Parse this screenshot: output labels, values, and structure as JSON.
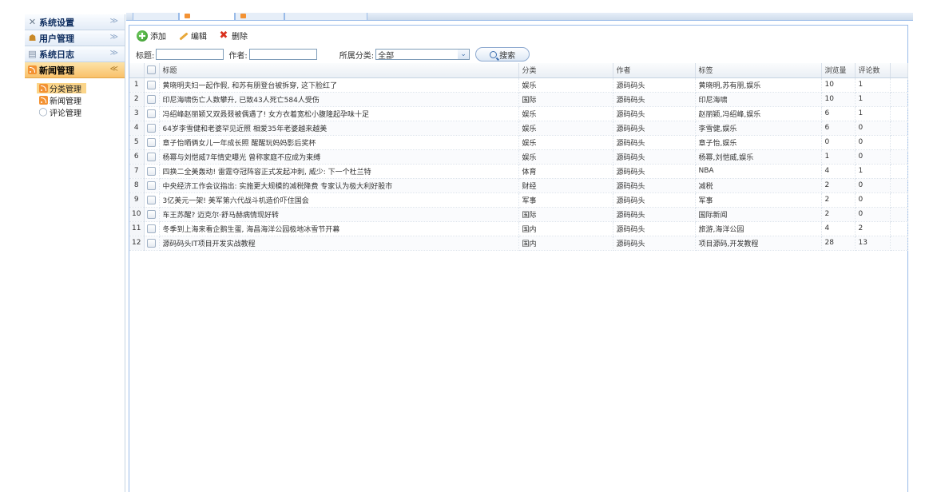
{
  "sidebar": {
    "sections": [
      {
        "label": "系统设置",
        "icon": "wrench-icon",
        "state": "collapsed"
      },
      {
        "label": "用户管理",
        "icon": "users-icon",
        "state": "collapsed"
      },
      {
        "label": "系统日志",
        "icon": "log-icon",
        "state": "collapsed"
      },
      {
        "label": "新闻管理",
        "icon": "rss-icon",
        "state": "expanded"
      }
    ],
    "news_items": [
      {
        "label": "分类管理",
        "icon": "rss-icon",
        "selected": true
      },
      {
        "label": "新闻管理",
        "icon": "rss-icon",
        "selected": false
      },
      {
        "label": "评论管理",
        "icon": "comment-icon",
        "selected": false
      }
    ]
  },
  "toolbar": {
    "add_label": "添加",
    "edit_label": "编辑",
    "delete_label": "删除"
  },
  "search": {
    "title_label": "标题:",
    "title_value": "",
    "author_label": "作者:",
    "author_value": "",
    "category_label": "所属分类:",
    "category_value": "全部",
    "search_button": "搜索"
  },
  "grid": {
    "columns": [
      "标题",
      "分类",
      "作者",
      "标签",
      "浏览量",
      "评论数"
    ],
    "rows": [
      {
        "n": "1",
        "title": "黄晓明夫妇一起作假, 和苏有朋登台被拆穿, 这下脸红了",
        "category": "娱乐",
        "author": "源码码头",
        "tags": "黄晓明,苏有朋,娱乐",
        "views": "10",
        "comments": "1"
      },
      {
        "n": "2",
        "title": "印尼海啸伤亡人数攀升, 已致43人死亡584人受伤",
        "category": "国际",
        "author": "源码码头",
        "tags": "印尼海啸",
        "views": "10",
        "comments": "1"
      },
      {
        "n": "3",
        "title": "冯绍峰赵丽颖又双叒叕被偶遇了! 女方衣着宽松小腹隆起孕味十足",
        "category": "娱乐",
        "author": "源码码头",
        "tags": "赵丽颖,冯绍峰,娱乐",
        "views": "6",
        "comments": "1"
      },
      {
        "n": "4",
        "title": "64岁李雪健和老婆罕见近照 相爱35年老婆越来越美",
        "category": "娱乐",
        "author": "源码码头",
        "tags": "李雪健,娱乐",
        "views": "6",
        "comments": "0"
      },
      {
        "n": "5",
        "title": "章子怡晒俩女儿一年成长照 醒醒玩妈妈影后奖杯",
        "category": "娱乐",
        "author": "源码码头",
        "tags": "章子怡,娱乐",
        "views": "0",
        "comments": "0"
      },
      {
        "n": "6",
        "title": "杨幂与刘恺威7年情史曝光 曾称家庭不应成为束缚",
        "category": "娱乐",
        "author": "源码码头",
        "tags": "杨幂,刘恺威,娱乐",
        "views": "1",
        "comments": "0"
      },
      {
        "n": "7",
        "title": "四换二全美轰动! 雷霆夺冠阵容正式发起冲刺, 威少: 下一个杜兰特",
        "category": "体育",
        "author": "源码码头",
        "tags": "NBA",
        "views": "4",
        "comments": "1"
      },
      {
        "n": "8",
        "title": "中央经济工作会议指出: 实施更大规模的减税降费 专家认为极大利好股市",
        "category": "财经",
        "author": "源码码头",
        "tags": "减税",
        "views": "2",
        "comments": "0"
      },
      {
        "n": "9",
        "title": "3亿美元一架! 美军第六代战斗机造价吓住国会",
        "category": "军事",
        "author": "源码码头",
        "tags": "军事",
        "views": "2",
        "comments": "0"
      },
      {
        "n": "10",
        "title": "车王苏醒? 迈克尔·舒马赫病情现好转",
        "category": "国际",
        "author": "源码码头",
        "tags": "国际新闻",
        "views": "2",
        "comments": "0"
      },
      {
        "n": "11",
        "title": "冬季到上海来看企鹅生蛋, 海昌海洋公园极地冰雪节开幕",
        "category": "国内",
        "author": "源码码头",
        "tags": "旅游,海洋公园",
        "views": "4",
        "comments": "2"
      },
      {
        "n": "12",
        "title": "源码码头IT项目开发实战教程",
        "category": "国内",
        "author": "源码码头",
        "tags": "项目源码,开发教程",
        "views": "28",
        "comments": "13"
      }
    ]
  }
}
